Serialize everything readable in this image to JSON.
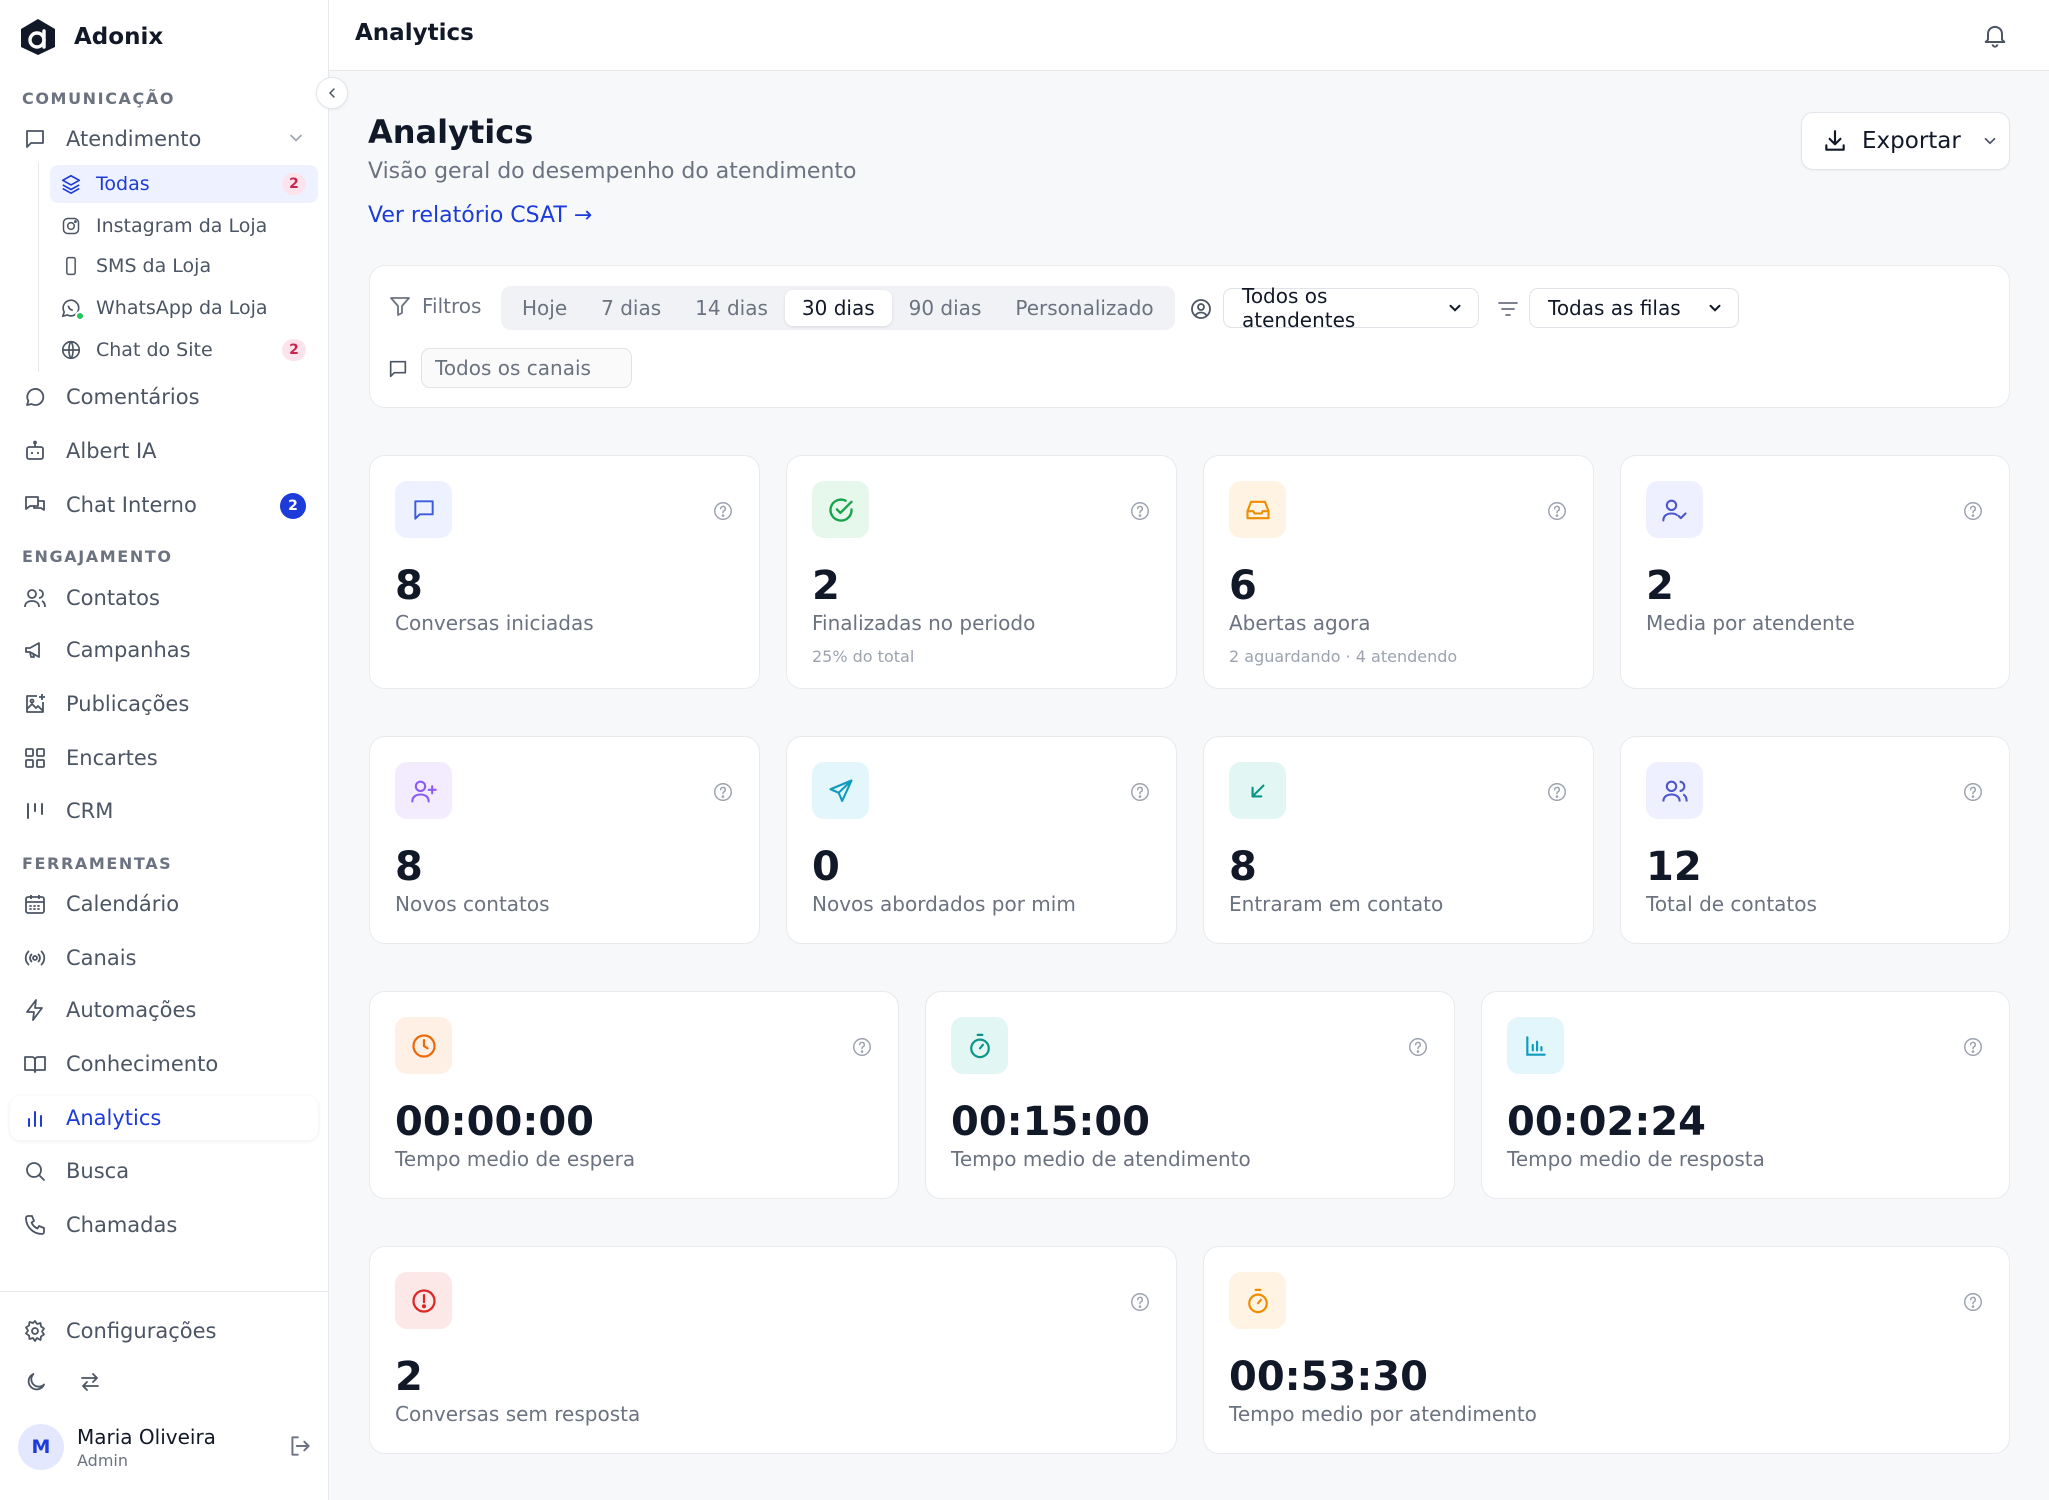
{
  "app": {
    "name": "Adonix"
  },
  "colors": {
    "primary": "#1d3bd8",
    "badge_pink_bg": "#fde4ec",
    "badge_pink_text": "#c8264f",
    "text_muted": "#6b7280"
  },
  "sidebar": {
    "sections": {
      "comunicacao": "COMUNICAÇÃO",
      "engajamento": "ENGAJAMENTO",
      "ferramentas": "FERRAMENTAS"
    },
    "atendimento": {
      "label": "Atendimento",
      "children": [
        {
          "label": "Todas",
          "badge": "2",
          "icon": "layers-icon"
        },
        {
          "label": "Instagram da Loja",
          "icon": "instagram-icon"
        },
        {
          "label": "SMS da Loja",
          "icon": "phone-device-icon"
        },
        {
          "label": "WhatsApp da Loja",
          "icon": "whatsapp-icon"
        },
        {
          "label": "Chat do Site",
          "badge": "2",
          "icon": "globe-icon"
        }
      ]
    },
    "items": {
      "comentarios": "Comentários",
      "albert": "Albert IA",
      "chat_interno": "Chat Interno",
      "chat_interno_badge": "2",
      "contatos": "Contatos",
      "campanhas": "Campanhas",
      "publicacoes": "Publicações",
      "encartes": "Encartes",
      "crm": "CRM",
      "calendario": "Calendário",
      "canais": "Canais",
      "automacoes": "Automações",
      "conhecimento": "Conhecimento",
      "analytics": "Analytics",
      "busca": "Busca",
      "chamadas": "Chamadas",
      "configuracoes": "Configurações"
    },
    "user": {
      "initial": "M",
      "name": "Maria Oliveira",
      "role": "Admin"
    }
  },
  "topbar": {
    "title": "Analytics"
  },
  "page": {
    "title": "Analytics",
    "subtitle": "Visão geral do desempenho do atendimento",
    "csat_link": "Ver relatório CSAT →",
    "export_label": "Exportar"
  },
  "filters": {
    "label": "Filtros",
    "ranges": [
      "Hoje",
      "7 dias",
      "14 dias",
      "30 dias",
      "90 dias",
      "Personalizado"
    ],
    "active_range": "30 dias",
    "agents_selected": "Todos os atendentes",
    "queues_selected": "Todas as filas",
    "channels_placeholder": "Todos os canais"
  },
  "metrics": {
    "conversas_iniciadas": {
      "value": "8",
      "label": "Conversas iniciadas"
    },
    "finalizadas": {
      "value": "2",
      "label": "Finalizadas no periodo",
      "sub": "25% do total"
    },
    "abertas": {
      "value": "6",
      "label": "Abertas agora",
      "sub": "2 aguardando · 4 atendendo"
    },
    "media_atendente": {
      "value": "2",
      "label": "Media por atendente"
    },
    "novos_contatos": {
      "value": "8",
      "label": "Novos contatos"
    },
    "novos_abordados": {
      "value": "0",
      "label": "Novos abordados por mim"
    },
    "entraram_contato": {
      "value": "8",
      "label": "Entraram em contato"
    },
    "total_contatos": {
      "value": "12",
      "label": "Total de contatos"
    },
    "tempo_espera": {
      "value": "00:00:00",
      "label": "Tempo medio de espera"
    },
    "tempo_atendimento": {
      "value": "00:15:00",
      "label": "Tempo medio de atendimento"
    },
    "tempo_resposta": {
      "value": "00:02:24",
      "label": "Tempo medio de resposta"
    },
    "sem_resposta": {
      "value": "2",
      "label": "Conversas sem resposta"
    },
    "tempo_por_atendimento": {
      "value": "00:53:30",
      "label": "Tempo medio por atendimento"
    }
  }
}
